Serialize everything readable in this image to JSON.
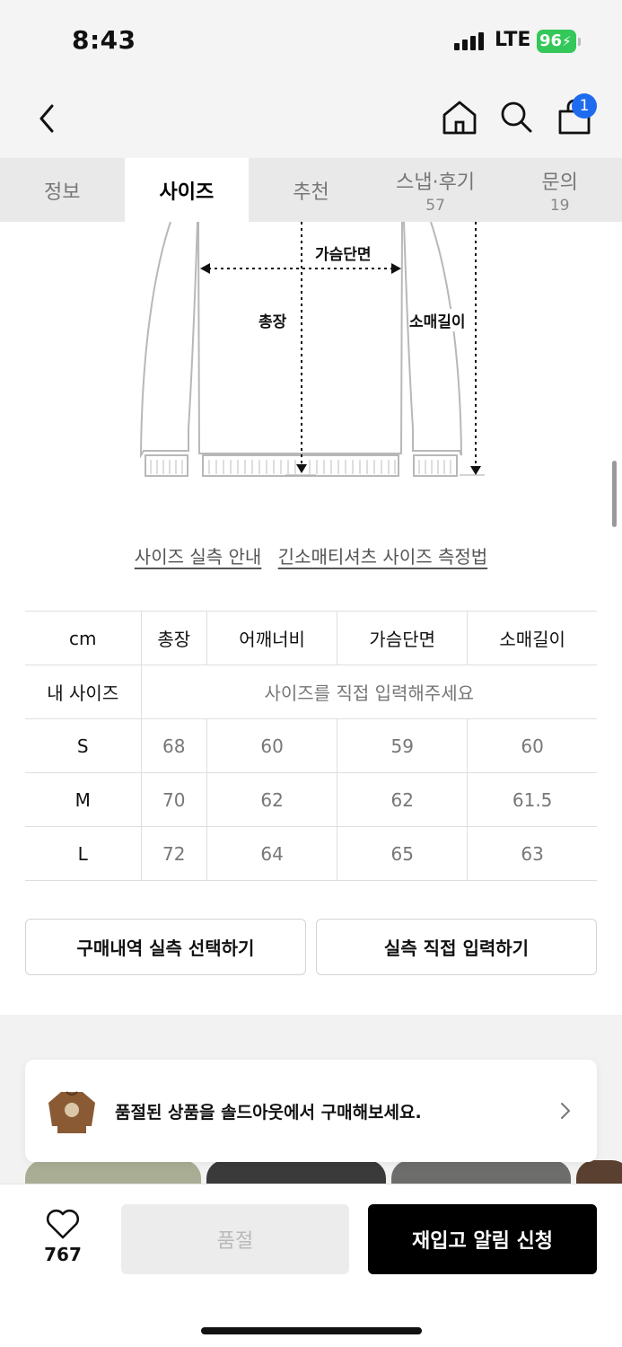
{
  "status": {
    "time": "8:43",
    "network": "LTE",
    "battery": "96"
  },
  "nav": {
    "cart_count": "1"
  },
  "tabs": [
    {
      "label": "정보",
      "count": ""
    },
    {
      "label": "사이즈",
      "count": ""
    },
    {
      "label": "추천",
      "count": ""
    },
    {
      "label": "스냅·후기",
      "count": "57"
    },
    {
      "label": "문의",
      "count": "19"
    }
  ],
  "diagram": {
    "chest": "가슴단면",
    "length": "총장",
    "sleeve": "소매길이"
  },
  "links": {
    "guide": "사이즈 실측 안내",
    "measure": "긴소매티셔츠 사이즈 측정법"
  },
  "size_table": {
    "unit": "cm",
    "headers": [
      "총장",
      "어깨너비",
      "가슴단면",
      "소매길이"
    ],
    "my_size_label": "내 사이즈",
    "my_size_placeholder": "사이즈를 직접 입력해주세요",
    "rows": [
      {
        "size": "S",
        "values": [
          "68",
          "60",
          "59",
          "60"
        ]
      },
      {
        "size": "M",
        "values": [
          "70",
          "62",
          "62",
          "61.5"
        ]
      },
      {
        "size": "L",
        "values": [
          "72",
          "64",
          "65",
          "63"
        ]
      }
    ]
  },
  "buttons": {
    "purchase_history": "구매내역 실측 선택하기",
    "manual_input": "실측 직접 입력하기"
  },
  "banner": {
    "text": "품절된 상품을 솔드아웃에서 구매해보세요."
  },
  "bottom": {
    "likes": "767",
    "sold_out": "품절",
    "restock": "재입고 알림 신청"
  }
}
